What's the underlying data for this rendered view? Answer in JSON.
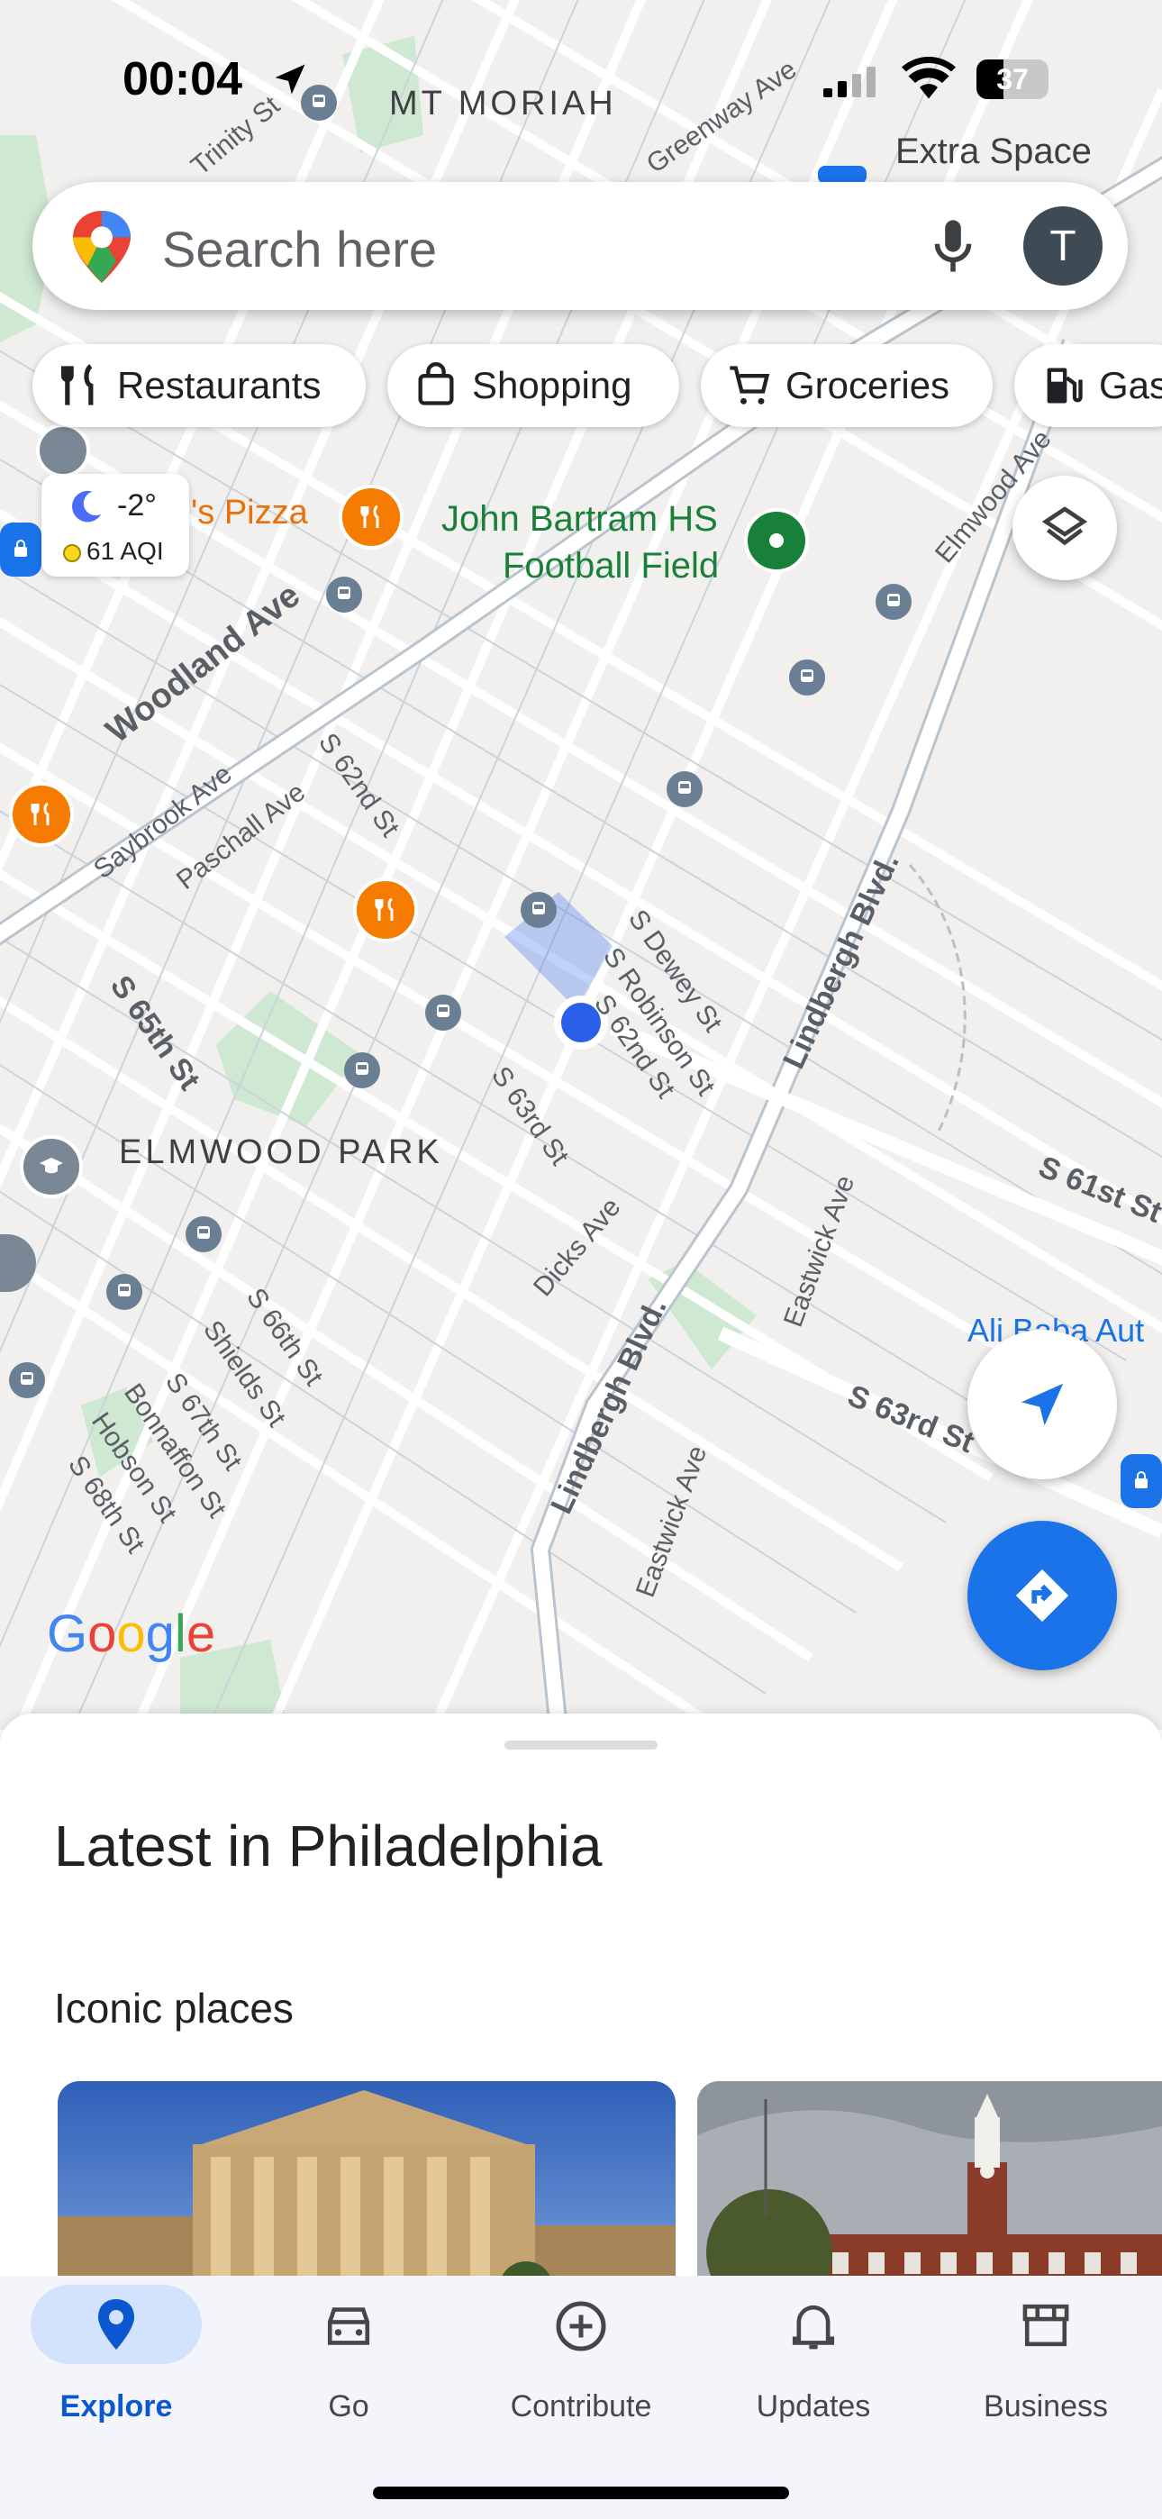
{
  "status_bar": {
    "time": "00:04",
    "battery": "37"
  },
  "search": {
    "placeholder": "Search here",
    "avatar_initial": "T"
  },
  "chips": [
    {
      "label": "Restaurants",
      "icon": "fork-knife-icon"
    },
    {
      "label": "Shopping",
      "icon": "shopping-bag-icon"
    },
    {
      "label": "Groceries",
      "icon": "cart-icon"
    },
    {
      "label": "Gas",
      "icon": "gas-pump-icon"
    }
  ],
  "weather": {
    "temp": "-2°",
    "aqi": "61 AQI",
    "icon": "moon-icon"
  },
  "map": {
    "labels": {
      "mt_moriah": "MT MORIAH",
      "extra_space": "Extra Space",
      "pizza": "'s Pizza",
      "john_bartram_1": "John Bartram HS",
      "john_bartram_2": "Football Field",
      "elmwood_park": "ELMWOOD PARK",
      "woodland_ave": "Woodland Ave",
      "saybrook_ave": "Saybrook Ave",
      "paschall_ave": "Paschall Ave",
      "s62nd": "S 62nd St",
      "s65th": "S 65th St",
      "s63rd": "S 63rd St",
      "dicks_ave": "Dicks Ave",
      "dewey": "S Dewey St",
      "robinson": "S Robinson St",
      "s62nd_b": "S 62nd St",
      "lindbergh_1": "Lindbergh Blvd.",
      "lindbergh_2": "Lindbergh Blvd.",
      "eastwick_1": "Eastwick Ave",
      "eastwick_2": "Eastwick Ave",
      "s61st": "S 61st St",
      "s63rd_b": "S 63rd St",
      "alibaba": "Ali Baba Aut",
      "s66th": "S 66th St",
      "shields": "Shields St",
      "s67th": "S 67th St",
      "bonnaffon": "Bonnaffon St",
      "hobson": "Hobson St",
      "s68th": "S 68th St",
      "elmwood_ave": "Elmwood Ave",
      "greenway": "Greenway Ave",
      "trinity": "Trinity St",
      "google": "Google"
    },
    "colors": {
      "road": "#ffffff",
      "road_outline": "#c8d0d8",
      "park": "#cfe8d2",
      "accent": "#1a73e8",
      "food": "#f57c00",
      "place": "#188038"
    }
  },
  "bottom_sheet": {
    "title": "Latest in Philadelphia",
    "section": "Iconic places",
    "cards": [
      {
        "name": "art-museum-card"
      },
      {
        "name": "independence-hall-card"
      }
    ]
  },
  "nav": [
    {
      "label": "Explore",
      "icon": "location-pin-icon",
      "active": true
    },
    {
      "label": "Go",
      "icon": "car-icon",
      "active": false
    },
    {
      "label": "Contribute",
      "icon": "add-circle-icon",
      "active": false
    },
    {
      "label": "Updates",
      "icon": "bell-icon",
      "active": false
    },
    {
      "label": "Business",
      "icon": "storefront-icon",
      "active": false
    }
  ]
}
